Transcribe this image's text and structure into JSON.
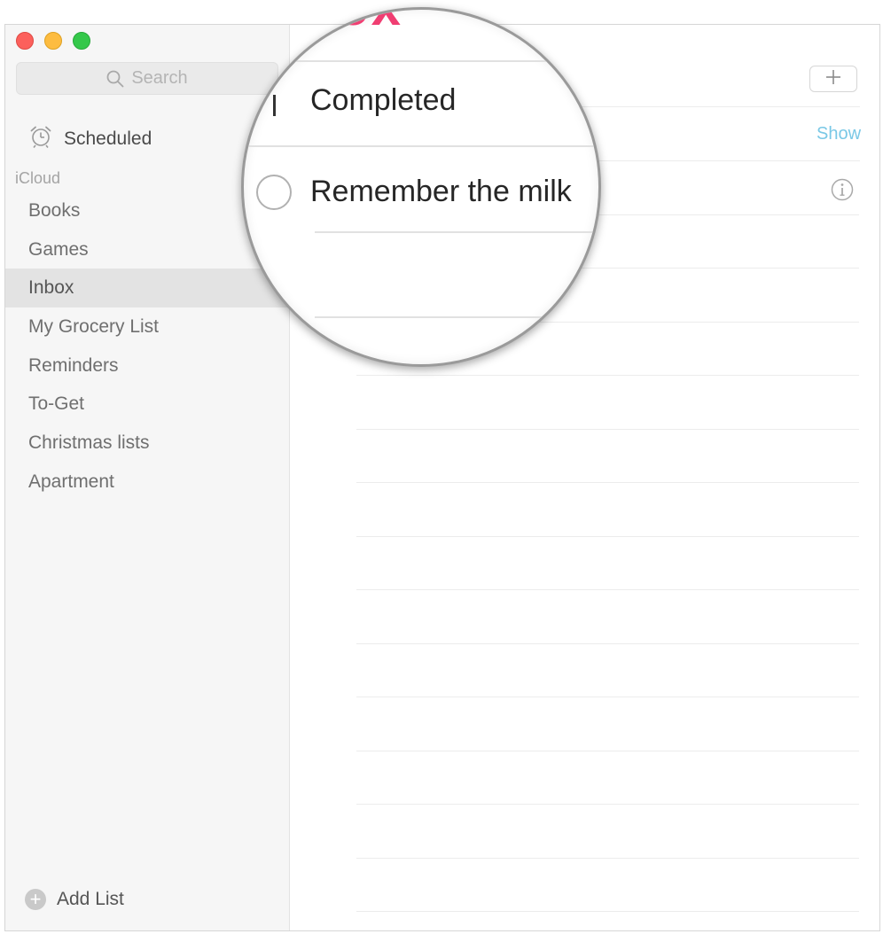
{
  "search": {
    "placeholder": "Search"
  },
  "sidebar": {
    "scheduled_label": "Scheduled",
    "section_label": "iCloud",
    "lists": [
      "Books",
      "Games",
      "Inbox",
      "My Grocery List",
      "Reminders",
      "To-Get",
      "Christmas lists",
      "Apartment"
    ],
    "selected_list": "Inbox",
    "add_list_label": "Add List"
  },
  "main": {
    "title_fragment": "ox",
    "add_button_symbol": "+",
    "completed_label": "Completed",
    "show_label": "Show",
    "tasks": [
      {
        "title": "Remember the milk",
        "completed": false
      }
    ]
  },
  "colors": {
    "accent_title": "#f03e72",
    "show_link": "#7ac8e6",
    "selected_row": "#e3e3e3"
  },
  "icons": [
    "search-icon",
    "alarm-clock-icon",
    "plus-icon",
    "info-icon",
    "plus-circle-icon"
  ]
}
